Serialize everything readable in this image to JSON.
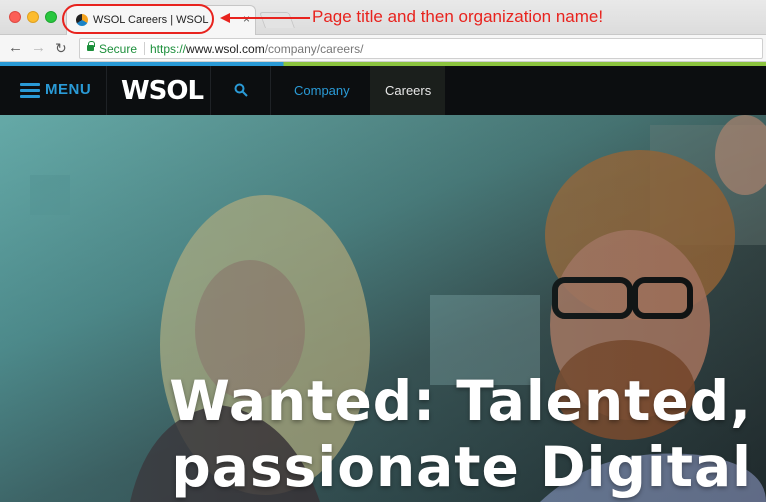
{
  "browser": {
    "tab": {
      "title": "WSOL Careers | WSOL",
      "close_glyph": "×",
      "favicon": "wsol-favicon"
    },
    "annotation": {
      "text": "Page title and then organization name!",
      "color": "#e8231e"
    },
    "toolbar": {
      "back_glyph": "←",
      "forward_glyph": "→",
      "reload_glyph": "↻",
      "secure_label": "Secure",
      "url_scheme": "https://",
      "url_host": "www.wsol.com",
      "url_path": "/company/careers/"
    }
  },
  "site": {
    "menu_label": "MENU",
    "logo_text": "WSOL",
    "nav": [
      {
        "label": "Company"
      },
      {
        "label": "Careers"
      }
    ],
    "colors": {
      "accent_blue": "#2a9ad6",
      "accent_green": "#8cc43f",
      "nav_bg": "#0c0e10"
    }
  },
  "hero": {
    "heading_line1": "Wanted: Talented,",
    "heading_line2": "passionate Digital"
  }
}
